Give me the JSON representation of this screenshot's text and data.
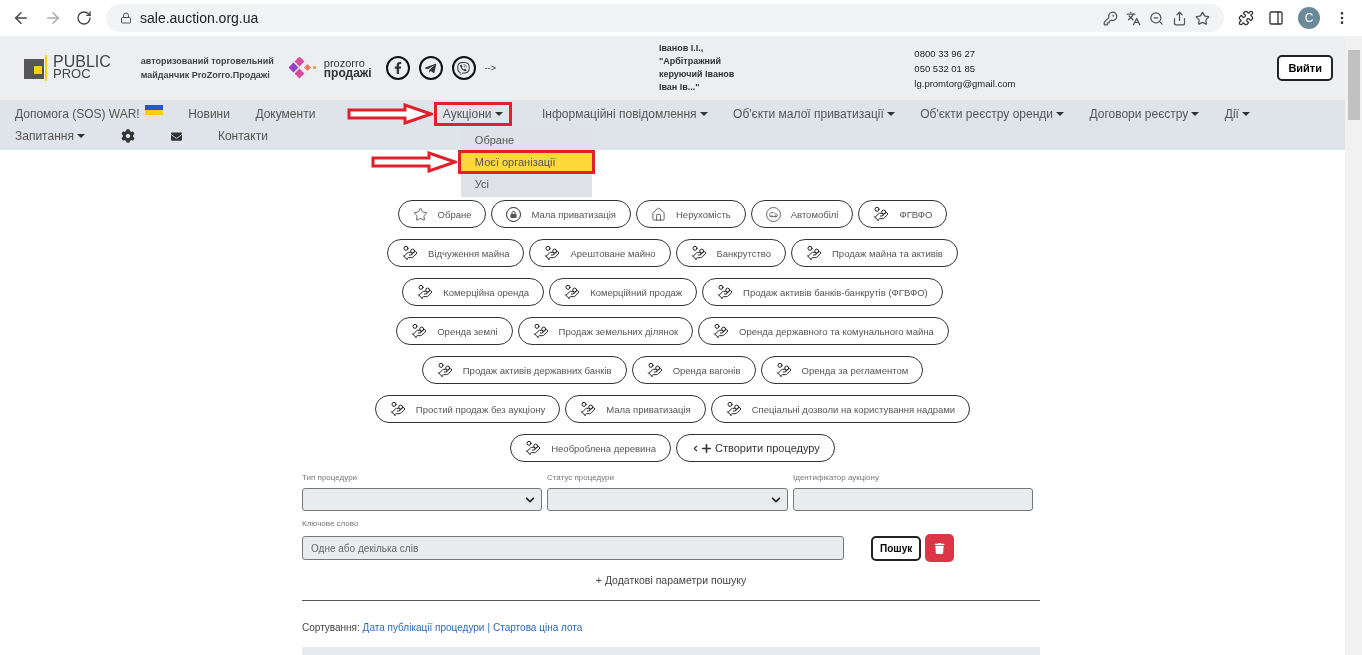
{
  "browser": {
    "url": "sale.auction.org.ua",
    "profile_initial": "C"
  },
  "header": {
    "logo": [
      "PUBLIC",
      "PROC"
    ],
    "tagline": [
      "авторизований торговельний",
      "майданчик ProZorro.Продажі"
    ],
    "prozorro": [
      "prozorro",
      "продажі"
    ],
    "arrow_text": "-->",
    "user_lines": [
      "Іванов І.І.,",
      "\"Арбітражний",
      "керуючий Іванов",
      "Іван Ів...\""
    ],
    "contacts": [
      "0800 33 96 27",
      "050 532 01 85",
      "lg.promtorg@gmail.com"
    ],
    "logout": "Вийти"
  },
  "nav": {
    "rows": [
      [
        {
          "kind": "link",
          "label": "Допомога (SOS) WAR!",
          "flag": true
        },
        {
          "kind": "link",
          "label": "Новини"
        },
        {
          "kind": "link",
          "label": "Документи"
        },
        {
          "kind": "dropdown",
          "label": "Аукціони",
          "marked": true,
          "expanded": true
        },
        {
          "kind": "dropdown",
          "label": "Інформаційні повідомлення"
        },
        {
          "kind": "dropdown",
          "label": "Об'єкти малої приватизації"
        },
        {
          "kind": "dropdown",
          "label": "Об'єкти реєстру оренди"
        },
        {
          "kind": "dropdown",
          "label": "Договори реєстру"
        },
        {
          "kind": "dropdown",
          "label": "Дії"
        }
      ],
      [
        {
          "kind": "dropdown",
          "label": "Запитання"
        },
        {
          "kind": "settings"
        },
        {
          "kind": "mail"
        },
        {
          "kind": "link",
          "label": "Контакти"
        }
      ]
    ]
  },
  "dropdown": [
    {
      "label": "Обране",
      "selected": false
    },
    {
      "label": "Моєї організації",
      "selected": true
    },
    {
      "label": "Усі",
      "selected": false
    }
  ],
  "category_rows": [
    [
      {
        "kind": "star",
        "label": "Обране"
      },
      {
        "kind": "lock",
        "label": "Мала приватизація"
      },
      {
        "kind": "house",
        "label": "Нерухомість"
      },
      {
        "kind": "car",
        "label": "Автомобілі"
      },
      {
        "kind": "coins",
        "label": "ФГВФО"
      }
    ],
    [
      {
        "kind": "coins",
        "label": "Відчуження майна"
      },
      {
        "kind": "coins",
        "label": "Арештоване майно"
      },
      {
        "kind": "coins",
        "label": "Банкрутство"
      },
      {
        "kind": "coins",
        "label": "Продаж майна та активів"
      }
    ],
    [
      {
        "kind": "coins",
        "label": "Комерційна оренда"
      },
      {
        "kind": "coins",
        "label": "Комерційний продаж"
      },
      {
        "kind": "coins",
        "label": "Продаж активів банків-банкрутів (ФГВФО)"
      }
    ],
    [
      {
        "kind": "coins",
        "label": "Оренда землі"
      },
      {
        "kind": "coins",
        "label": "Продаж земельних ділянок"
      },
      {
        "kind": "coins",
        "label": "Оренда державного та комунального майна"
      }
    ],
    [
      {
        "kind": "coins",
        "label": "Продаж активів державних банків"
      },
      {
        "kind": "coins",
        "label": "Оренда вагонів"
      },
      {
        "kind": "coins",
        "label": "Оренда за регламентом"
      }
    ],
    [
      {
        "kind": "coins",
        "label": "Простий продаж без аукціону"
      },
      {
        "kind": "coins",
        "label": "Мала приватизація"
      },
      {
        "kind": "coins",
        "label": "Спеціальні дозволи на користування надрами"
      }
    ],
    [
      {
        "kind": "coins",
        "label": "Необроблена деревина"
      },
      {
        "kind": "create",
        "label": "Створити процедуру"
      }
    ]
  ],
  "filters": {
    "fields": [
      {
        "kind": "select",
        "label": "Тип процедури"
      },
      {
        "kind": "select",
        "label": "Статус процедури"
      },
      {
        "kind": "text",
        "label": "Ідентифікатор аукціону"
      }
    ],
    "keyword": {
      "label": "Ключове слово",
      "placeholder": "Одне або декілька слів"
    },
    "search": "Пошук",
    "more": "+ Додаткові параметри пошуку"
  },
  "sort": {
    "label": "Сортування:",
    "links": [
      "Дата публікації процедури",
      "Стартова ціна лота"
    ],
    "separator": "|"
  }
}
